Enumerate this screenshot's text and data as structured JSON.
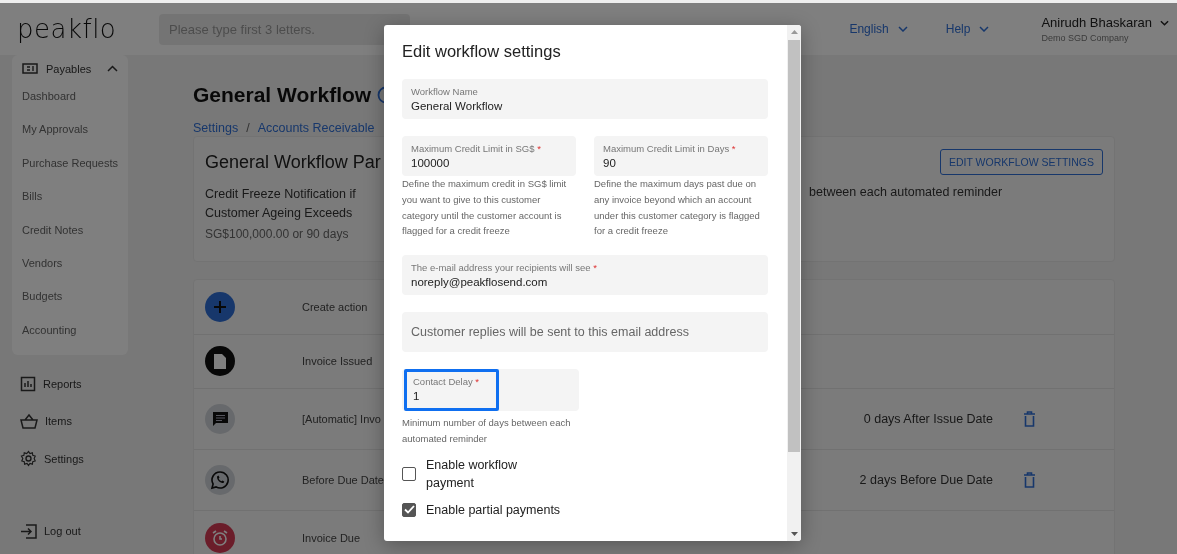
{
  "header": {
    "logo": "peakflo",
    "search": {
      "placeholder": "Please type first 3 letters."
    },
    "language": "English",
    "help": "Help",
    "user": {
      "name": "Anirudh Bhaskaran",
      "company": "Demo SGD Company"
    }
  },
  "sidebar": {
    "section": {
      "label": "Payables",
      "expanded": true,
      "items": [
        "Dashboard",
        "My Approvals",
        "Purchase Requests",
        "Bills",
        "Credit Notes",
        "Vendors",
        "Budgets",
        "Accounting"
      ]
    },
    "nav": [
      {
        "kind": "reports",
        "label": "Reports"
      },
      {
        "kind": "items",
        "label": "Items"
      },
      {
        "kind": "settings",
        "label": "Settings"
      }
    ],
    "logout": "Log out"
  },
  "page": {
    "title": "General Workflow",
    "breadcrumbs": [
      "Settings",
      "Accounts Receivable"
    ],
    "breadcrumb_separator": "/",
    "card": {
      "title": "General Workflow Par",
      "rule_label": "Credit Freeze Notification if Customer Ageing Exceeds",
      "rule_value": "SG$100,000.00 or 90 days",
      "delay_text": "between each automated reminder",
      "button": "EDIT WORKFLOW SETTINGS"
    },
    "actions": [
      {
        "kind": "add",
        "label": "Create action"
      },
      {
        "kind": "document",
        "label": "Invoice Issued"
      },
      {
        "kind": "chat",
        "label": "[Automatic] Invo",
        "timing": "0 days After Issue Date"
      },
      {
        "kind": "whatsapp",
        "label": "Before Due Date",
        "timing": "2 days Before Due Date"
      },
      {
        "kind": "alarm",
        "label": "Invoice Due"
      }
    ]
  },
  "modal": {
    "title": "Edit workflow settings",
    "workflow_name": {
      "label": "Workflow Name",
      "value": "General Workflow"
    },
    "credit_limit": {
      "label": "Maximum Credit Limit in SG$",
      "required_mark": "*",
      "value": "100000",
      "help": "Define the maximum credit in SG$ limit you want to give to this customer category until the customer account is flagged for a credit freeze"
    },
    "credit_days": {
      "label": "Maximum Credit Limit in Days",
      "required_mark": "*",
      "value": "90",
      "help": "Define the maximum days past due on any invoice beyond which an account under this customer category is flagged for a credit freeze"
    },
    "sender_email": {
      "label": "The e-mail address your recipients will see",
      "required_mark": "*",
      "value": "noreply@peakflosend.com"
    },
    "reply_email": {
      "placeholder": "Customer replies will be sent to this email address"
    },
    "contact_delay": {
      "label": "Contact Delay",
      "required_mark": "*",
      "value": "1",
      "focused": true,
      "help": "Minimum number of days between each automated reminder"
    },
    "checkboxes": [
      {
        "label": "Enable workflow payment",
        "checked": false
      },
      {
        "label": "Enable partial payments",
        "checked": true
      }
    ]
  }
}
